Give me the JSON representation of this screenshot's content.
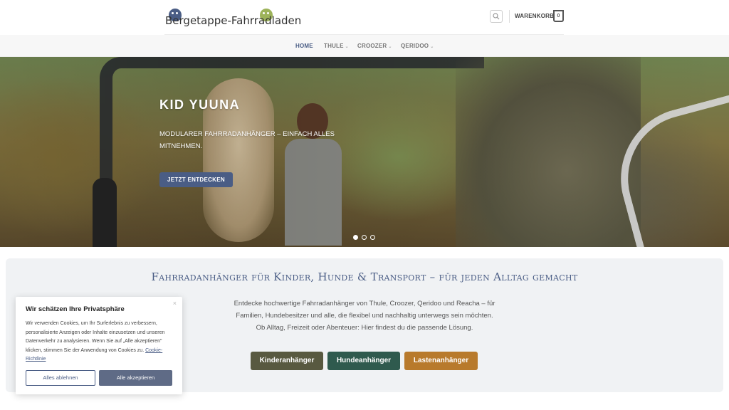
{
  "header": {
    "logo_text": "Bergetappe-Fahrradladen",
    "cart_label": "WARENKORB",
    "cart_count": "0"
  },
  "nav": {
    "items": [
      {
        "label": "HOME",
        "active": true
      },
      {
        "label": "THULE",
        "caret": "⌄"
      },
      {
        "label": "CROOZER",
        "caret": "⌄"
      },
      {
        "label": "QERIDOO",
        "caret": "⌄"
      }
    ]
  },
  "hero": {
    "title": "KID YUUNA",
    "subtitle": "MODULARER FAHRRADANHÄNGER – EINFACH ALLES MITNEHMEN.",
    "cta": "JETZT ENTDECKEN",
    "slides_total": 3,
    "slide_active": 1
  },
  "section": {
    "title": "Fahrradanhänger für Kinder, Hunde & Transport – für jeden Alltag gemacht",
    "text_line1": "Entdecke hochwertige Fahrradanhänger von Thule, Croozer, Qeridoo und Reacha – für Familien, Hundebesitzer und alle, die flexibel und nachhaltig unterwegs sein möchten.",
    "text_line2": "Ob Alltag, Freizeit oder Abenteuer: Hier findest du die passende Lösung.",
    "buttons": [
      {
        "label": "Kinderanhänger",
        "color": "#585940"
      },
      {
        "label": "Hundeanhänger",
        "color": "#2f5a4e"
      },
      {
        "label": "Lastenanhänger",
        "color": "#b87a2c"
      }
    ]
  },
  "cookie": {
    "title": "Wir schätzen Ihre Privatsphäre",
    "text": "Wir verwenden Cookies, um Ihr Surferlebnis zu verbessern, personalisierte Anzeigen oder Inhalte einzusetzen und unseren Datenverkehr zu analysieren. Wenn Sie auf „Alle akzeptieren\" klicken, stimmen Sie der Anwendung von Cookies zu.",
    "link": "Cookie-Richtlinie",
    "decline": "Alles ablehnen",
    "accept": "Alle akzeptieren",
    "close_glyph": "×"
  },
  "colors": {
    "accent": "#4a5d85",
    "section_bg": "#f0f2f4"
  }
}
